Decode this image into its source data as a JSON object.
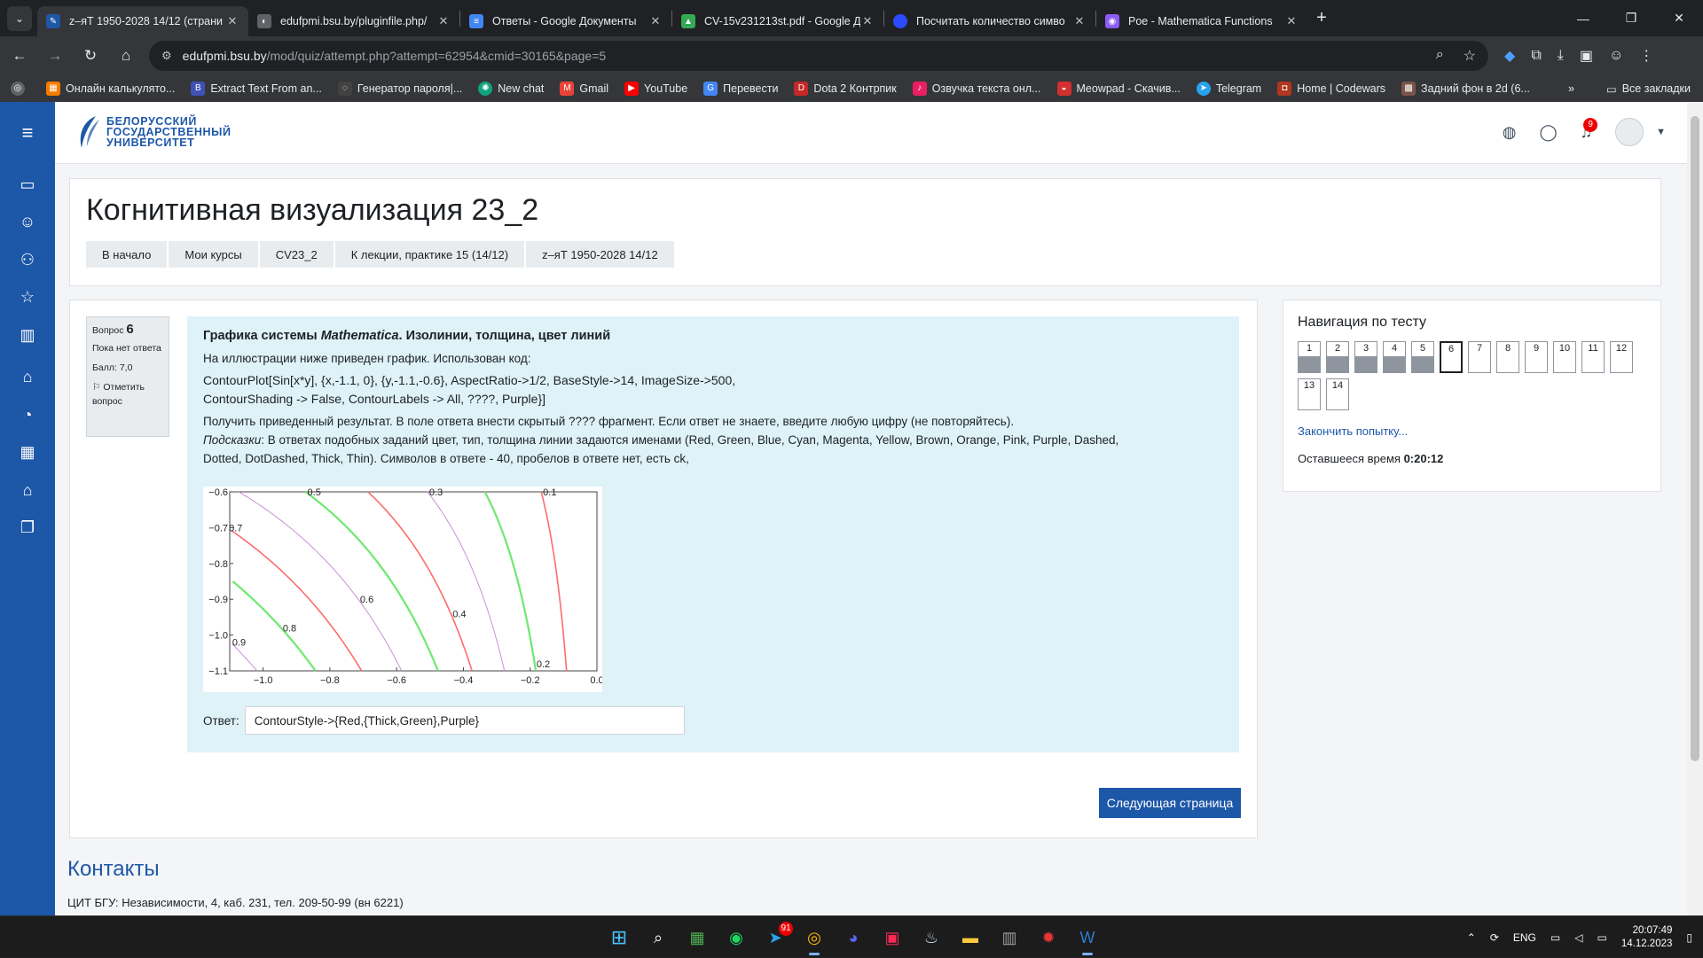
{
  "browser": {
    "tabs": [
      {
        "title": "z–яТ 1950-2028 14/12 (страни",
        "active": true,
        "favicon_color": "#1d57a8"
      },
      {
        "title": "edufpmi.bsu.by/pluginfile.php/",
        "active": false,
        "favicon_color": "#5f6368"
      },
      {
        "title": "Ответы - Google Документы",
        "active": false,
        "favicon_color": "#4285f4"
      },
      {
        "title": "CV-15v231213st.pdf - Google Д",
        "active": false,
        "favicon_color": "#34a853"
      },
      {
        "title": "Посчитать количество симво",
        "active": false,
        "favicon_color": "#2c4bff"
      },
      {
        "title": "Poe - Mathematica Functions",
        "active": false,
        "favicon_color": "#8b5cf6"
      }
    ],
    "url_host": "edufpmi.bsu.by",
    "url_path": "/mod/quiz/attempt.php?attempt=62954&cmid=30165&page=5",
    "bookmarks": [
      {
        "label": "Онлайн калькулято...",
        "color": "#f57c00"
      },
      {
        "label": "Extract Text From an...",
        "color": "#3f51b5"
      },
      {
        "label": "Генератор пароля|...",
        "color": "#424242"
      },
      {
        "label": "New chat",
        "color": "#10a37f"
      },
      {
        "label": "Gmail",
        "color": "#ea4335"
      },
      {
        "label": "YouTube",
        "color": "#ff0000"
      },
      {
        "label": "Перевести",
        "color": "#4285f4"
      },
      {
        "label": "Dota 2 Контрпик",
        "color": "#c62828"
      },
      {
        "label": "Озвучка текста онл...",
        "color": "#e91e63"
      },
      {
        "label": "Meowpad - Скачив...",
        "color": "#d32f2f"
      },
      {
        "label": "Telegram",
        "color": "#2aa3ef"
      },
      {
        "label": "Home | Codewars",
        "color": "#b1361e"
      },
      {
        "label": "Задний фон в 2d (6...",
        "color": "#795548"
      }
    ],
    "all_bookmarks": "Все закладки"
  },
  "site": {
    "logo_lines": [
      "БЕЛОРУССКИЙ",
      "ГОСУДАРСТВЕННЫЙ",
      "УНИВЕРСИТЕТ"
    ],
    "notification_count": "9"
  },
  "header": {
    "title": "Когнитивная визуализация 23_2",
    "breadcrumbs": [
      "В начало",
      "Мои курсы",
      "CV23_2",
      "К лекции, практике 15 (14/12)",
      "z–яТ 1950-2028 14/12"
    ]
  },
  "question": {
    "label": "Вопрос",
    "number": "6",
    "status": "Пока нет ответа",
    "score": "Балл: 7,0",
    "flag": "Отметить вопрос",
    "title_bold_1": "Графика системы ",
    "title_italic": "Mathematica",
    "title_bold_2": ". Изолинии, толщина, цвет линий",
    "intro": "На иллюстрации ниже приведен график. Использован код:",
    "code_1": "ContourPlot[Sin[x*y], {x,-1.1, 0}, {y,-1.1,-0.6}, AspectRatio->1/2, BaseStyle->14, ImageSize->500,",
    "code_2": "ContourShading -> False, ContourLabels -> All, ????, Purple}]",
    "task": "Получить приведенный результат. В поле ответа внести скрытый ???? фрагмент. Если ответ не знаете, введите любую цифру (не повторяйтесь).",
    "hint_label": "Подсказки",
    "hint_1": ": В ответах подобных заданий цвет, тип, толщина линии задаются именами (Red, Green, Blue, Cyan, Magenta, Yellow, Brown, Orange, Pink, Purple, Dashed,",
    "hint_2": "Dotted, DotDashed, Thick, Thin). Символов в ответе - 40, пробелов в ответе нет, есть ck,",
    "answer_label": "Ответ:",
    "answer_value": "ContourStyle->{Red,{Thick,Green},Purple}",
    "next_button": "Следующая страница"
  },
  "chart_data": {
    "type": "line",
    "title": "",
    "xlabel": "",
    "ylabel": "",
    "xlim": [
      -1.1,
      0
    ],
    "ylim": [
      -1.1,
      -0.6
    ],
    "x_ticks": [
      "−1.0",
      "−0.8",
      "−0.6",
      "−0.4",
      "−0.2",
      "0.0"
    ],
    "y_ticks": [
      "−0.6",
      "−0.7",
      "−0.8",
      "−0.9",
      "−1.0",
      "−1.1"
    ],
    "contour_levels": [
      0.1,
      0.2,
      0.3,
      0.4,
      0.5,
      0.6,
      0.7,
      0.8,
      0.9
    ],
    "contour_colors": {
      "0.1": "#ff6b6b",
      "0.2": "#6ee96e",
      "0.3": "#c98fd6",
      "0.4": "#ff6b6b",
      "0.5": "#6ee96e",
      "0.6": "#c98fd6",
      "0.7": "#ff6b6b",
      "0.8": "#6ee96e",
      "0.9": "#c98fd6"
    },
    "labels_shown": [
      "0.5",
      "0.3",
      "0.1",
      "0.7",
      "0.6",
      "0.4",
      "0.8",
      "0.9",
      "0.2"
    ]
  },
  "quiz_nav": {
    "title": "Навигация по тесту",
    "buttons": [
      {
        "n": "1",
        "answered": true
      },
      {
        "n": "2",
        "answered": true
      },
      {
        "n": "3",
        "answered": true
      },
      {
        "n": "4",
        "answered": true
      },
      {
        "n": "5",
        "answered": true
      },
      {
        "n": "6",
        "answered": false,
        "current": true
      },
      {
        "n": "7",
        "answered": false
      },
      {
        "n": "8",
        "answered": false
      },
      {
        "n": "9",
        "answered": false
      },
      {
        "n": "10",
        "answered": false
      },
      {
        "n": "11",
        "answered": false
      },
      {
        "n": "12",
        "answered": false
      },
      {
        "n": "13",
        "answered": false
      },
      {
        "n": "14",
        "answered": false
      }
    ],
    "finish": "Закончить попытку...",
    "time_label": "Оставшееся время",
    "time_value": "0:20:12"
  },
  "footer": {
    "title": "Контакты",
    "address": "ЦИТ БГУ: Независимости, 4, каб. 231, тел. 209-50-99 (вн 6221)"
  },
  "taskbar": {
    "lang": "ENG",
    "time": "20:07:49",
    "date": "14.12.2023",
    "telegram_badge": "91"
  }
}
